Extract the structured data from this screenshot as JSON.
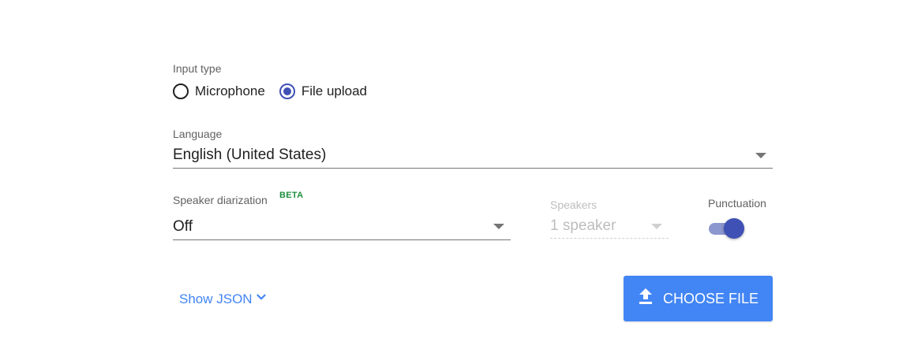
{
  "input_type": {
    "label": "Input type",
    "options": [
      {
        "label": "Microphone",
        "selected": false
      },
      {
        "label": "File upload",
        "selected": true
      }
    ]
  },
  "language": {
    "label": "Language",
    "value": "English (United States)"
  },
  "diarization": {
    "label": "Speaker diarization",
    "badge": "BETA",
    "value": "Off"
  },
  "speakers": {
    "label": "Speakers",
    "value": "1 speaker",
    "disabled": true
  },
  "punctuation": {
    "label": "Punctuation",
    "enabled": true
  },
  "show_json": {
    "label": "Show JSON",
    "icon": "chevron-down-icon"
  },
  "choose_file": {
    "label": "CHOOSE FILE",
    "icon": "upload-icon"
  },
  "colors": {
    "accent": "#3f51b5",
    "link": "#4285f4",
    "button": "#4285f4",
    "beta": "#1e8e3e"
  }
}
